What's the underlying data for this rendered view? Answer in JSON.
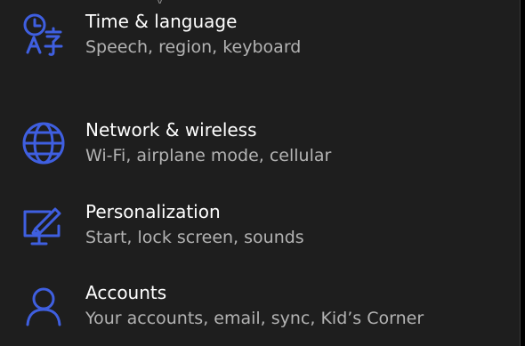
{
  "colors": {
    "background": "#1e1e1e",
    "accent": "#3f5fe0",
    "title": "#ffffff",
    "subtitle": "#b3b3b3"
  },
  "settings": {
    "top_fragment": "y",
    "items": [
      {
        "icon": "globe-icon",
        "title": "Network & wireless",
        "subtitle": "Wi-Fi, airplane mode, cellular"
      },
      {
        "icon": "personalization-icon",
        "title": "Personalization",
        "subtitle": "Start, lock screen, sounds"
      },
      {
        "icon": "person-icon",
        "title": "Accounts",
        "subtitle": "Your accounts, email, sync, Kid’s Corner"
      },
      {
        "icon": "time-language-icon",
        "title": "Time & language",
        "subtitle": "Speech, region, keyboard"
      }
    ]
  }
}
